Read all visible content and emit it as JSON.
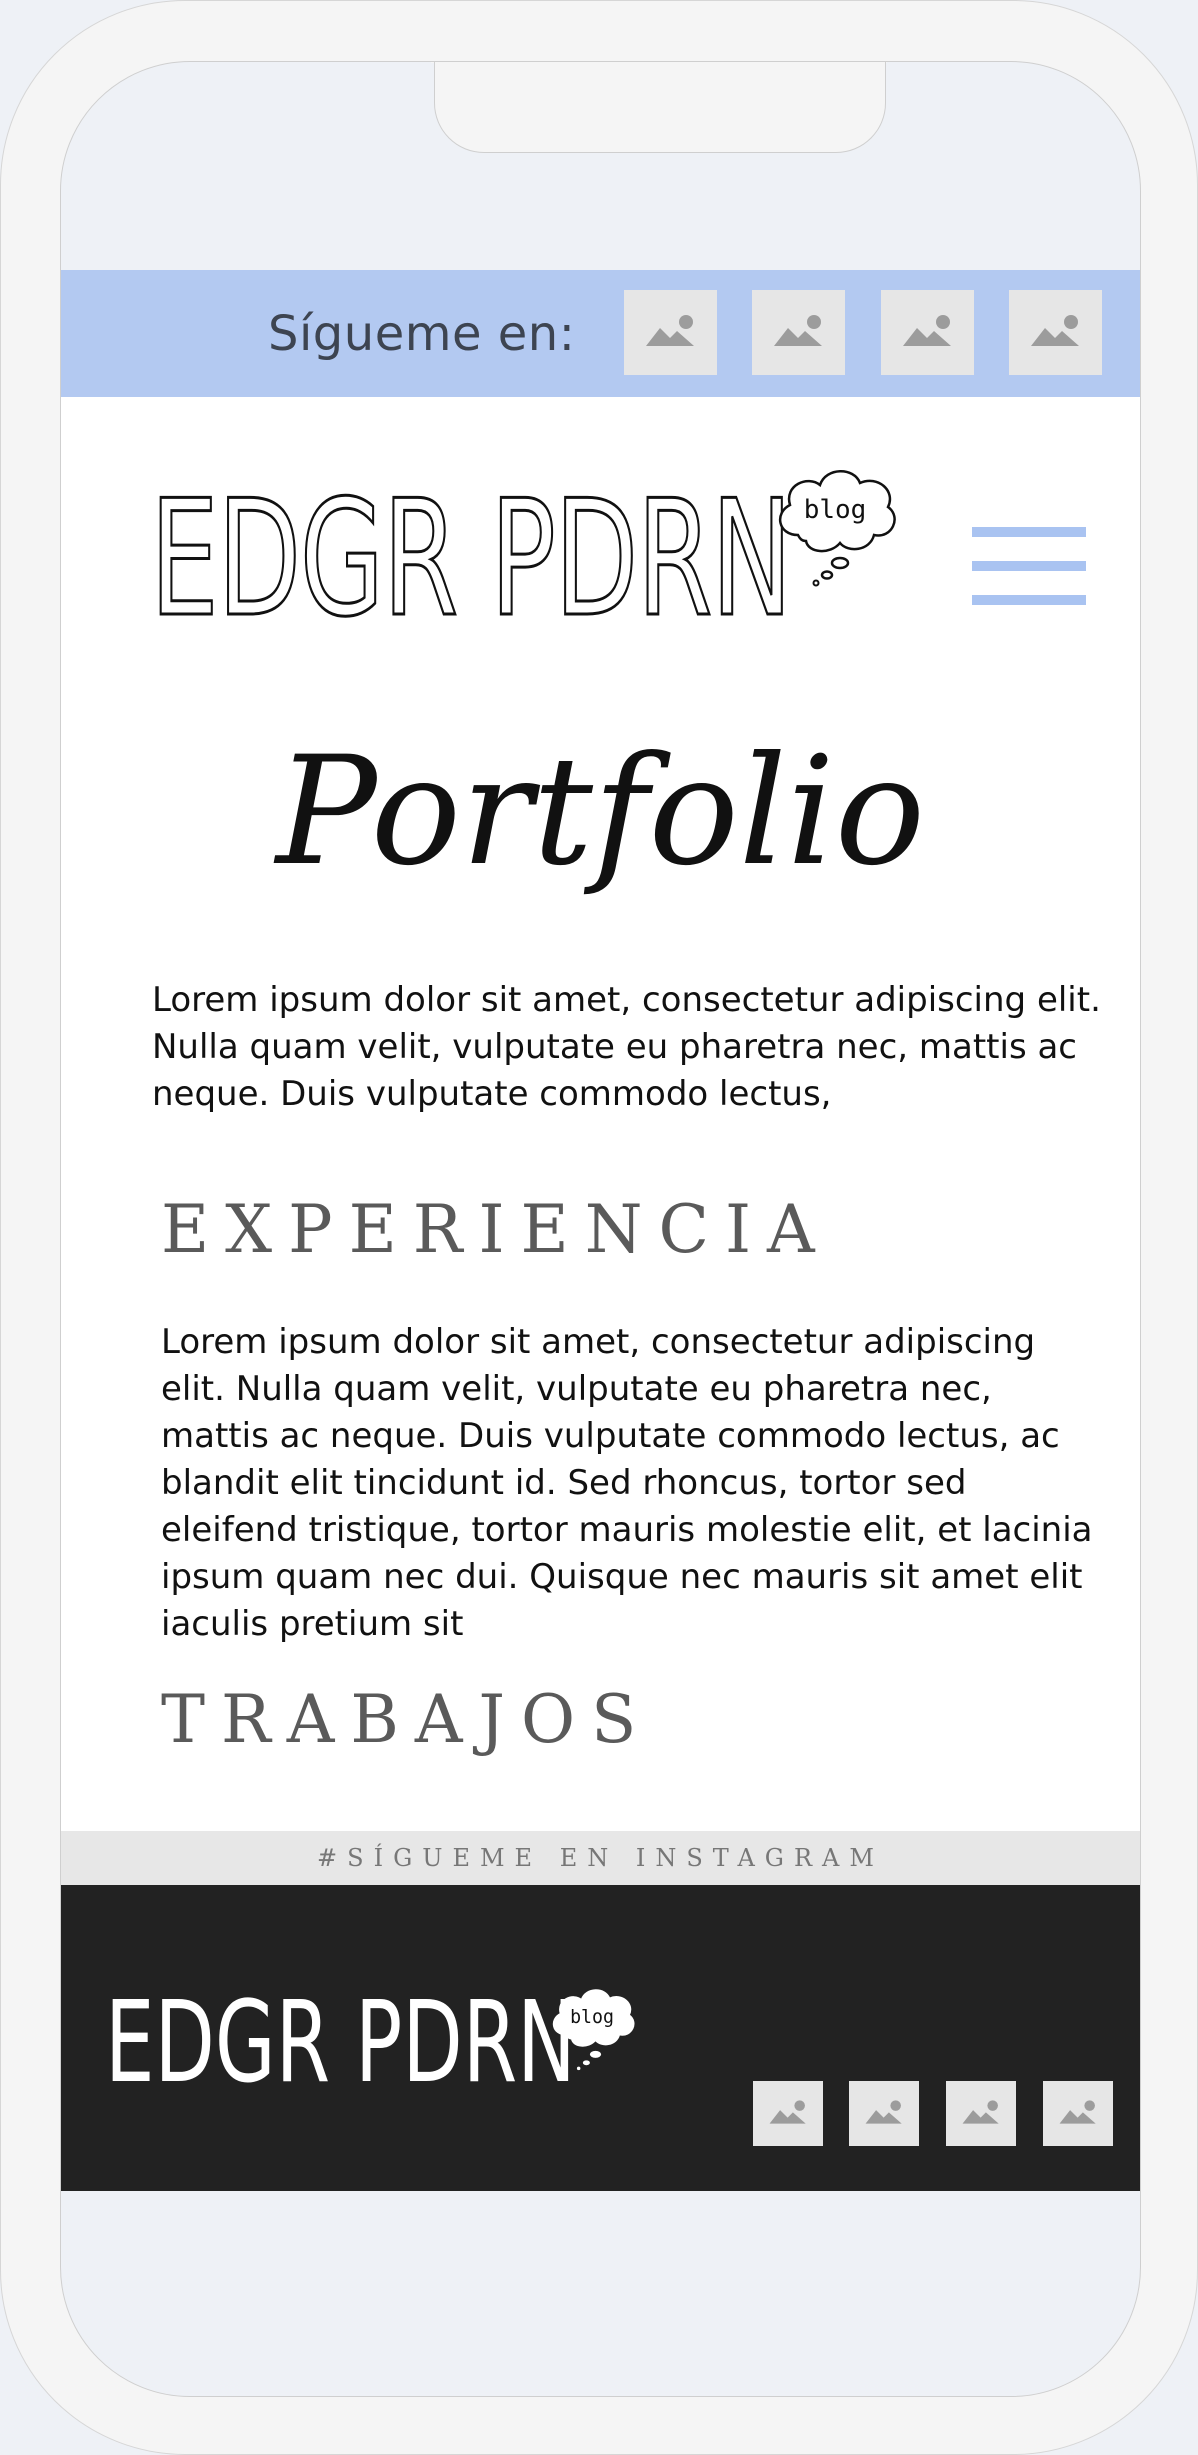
{
  "social_bar": {
    "label": "Sígueme en:",
    "icons": [
      "image-placeholder-icon",
      "image-placeholder-icon",
      "image-placeholder-icon",
      "image-placeholder-icon"
    ]
  },
  "header": {
    "logo": "EDGR PDRN",
    "logo_badge": "blog",
    "menu_icon": "hamburger-menu-icon"
  },
  "main": {
    "title": "Portfolio",
    "intro": "Lorem ipsum dolor sit amet, consectetur adipiscing elit. Nulla quam velit, vulputate eu pharetra nec, mattis ac neque. Duis vulputate commodo lectus,",
    "experience": {
      "heading": "EXPERIENCIA",
      "text": "Lorem ipsum dolor sit amet, consectetur adipiscing elit. Nulla quam velit, vulputate eu pharetra nec, mattis ac neque. Duis vulputate commodo lectus, ac blandit elit tincidunt id. Sed rhoncus, tortor sed eleifend tristique, tortor mauris molestie elit, et lacinia ipsum quam nec dui. Quisque nec mauris sit amet elit iaculis pretium sit"
    },
    "works": {
      "heading": "TRABAJOS"
    }
  },
  "instagram_bar": {
    "text": "#SÍGUEME EN INSTAGRAM"
  },
  "footer": {
    "logo": "EDGR PDRN",
    "logo_badge": "blog",
    "icons": [
      "image-placeholder-icon",
      "image-placeholder-icon",
      "image-placeholder-icon",
      "image-placeholder-icon"
    ]
  },
  "colors": {
    "accent": "#b3c9f1",
    "menu": "#a9c3f1",
    "footer_bg": "#222222",
    "placeholder": "#e6e6e6"
  }
}
